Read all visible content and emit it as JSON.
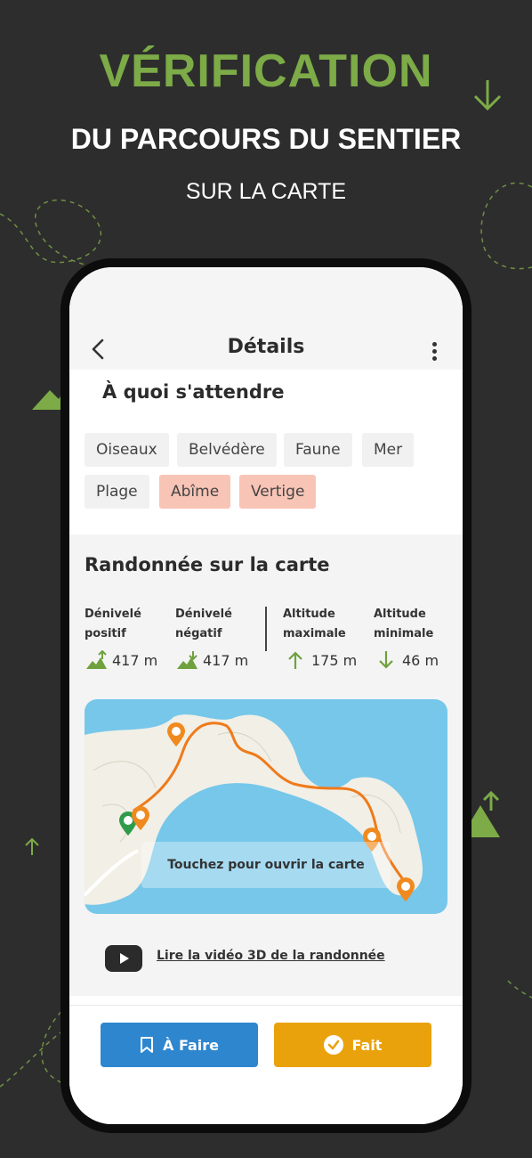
{
  "header": {
    "line1": "VÉRIFICATION",
    "line2": "DU PARCOURS DU SENTIER",
    "line3": "SUR LA CARTE"
  },
  "appbar": {
    "title": "Détails"
  },
  "expect": {
    "title": "À quoi s'attendre",
    "tags": [
      {
        "label": "Oiseaux"
      },
      {
        "label": "Belvédère"
      },
      {
        "label": "Faune"
      },
      {
        "label": "Mer"
      },
      {
        "label": "Plage"
      },
      {
        "label": "Abîme"
      },
      {
        "label": "Vertige"
      }
    ]
  },
  "map_section": {
    "title": "Randonnée sur la carte",
    "stats": [
      {
        "label": "Dénivelé\npositif",
        "value": "417 m",
        "icon": "elevation-up-icon"
      },
      {
        "label": "Dénivelé\nnégatif",
        "value": "417 m",
        "icon": "elevation-down-icon"
      },
      {
        "label": "Altitude\nmaximale",
        "value": "175 m",
        "icon": "arrow-up-icon"
      },
      {
        "label": "Altitude\nminimale",
        "value": "46 m",
        "icon": "arrow-down-icon"
      }
    ],
    "map_overlay": "Touchez pour ouvrir la carte",
    "video_link": "Lire la vidéo 3D de la randonnée"
  },
  "actions": {
    "todo": "À Faire",
    "done": "Fait"
  },
  "colors": {
    "background": "#2d2d2d",
    "accent_green": "#7cab47",
    "todo_blue": "#2e86cf",
    "done_orange": "#eaa20c",
    "warn_chip": "#f8c4b6",
    "route": "#ef7a1a"
  }
}
